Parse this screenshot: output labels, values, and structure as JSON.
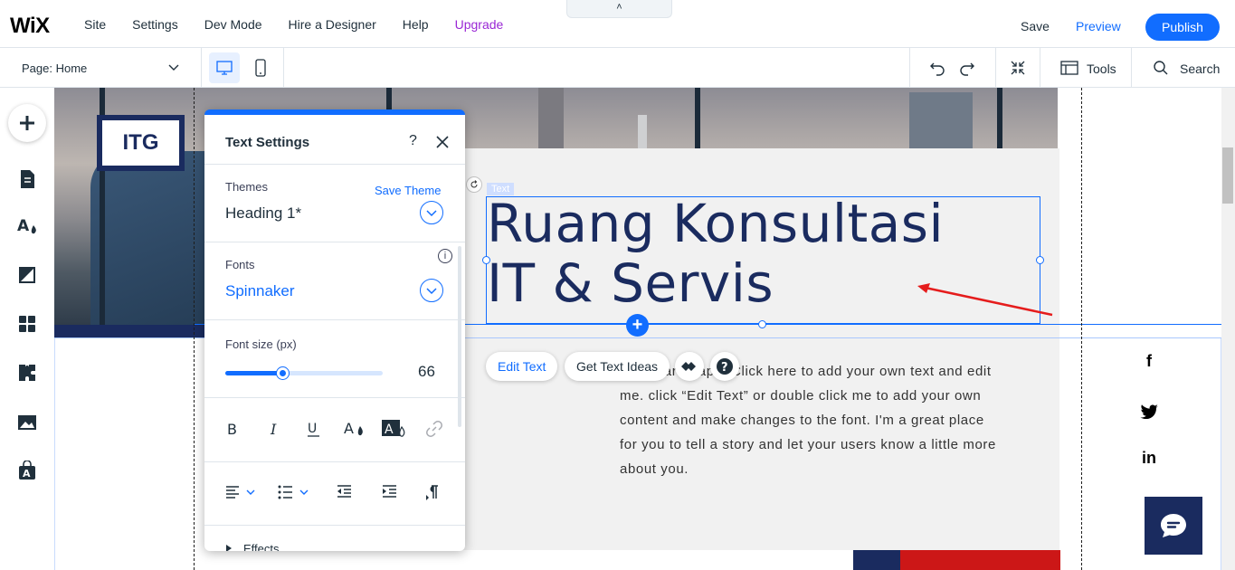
{
  "topbar": {
    "logo": "WiX",
    "nav": [
      "Site",
      "Settings",
      "Dev Mode",
      "Hire a Designer",
      "Help",
      "Upgrade"
    ],
    "collapse_glyph": "˄",
    "save": "Save",
    "preview": "Preview",
    "publish": "Publish"
  },
  "subbar": {
    "page_label": "Page: Home",
    "tools": "Tools",
    "search": "Search"
  },
  "leftbar": {
    "items": [
      "add-icon",
      "pages-icon",
      "design-icon",
      "background-icon",
      "apps-icon",
      "business-icon",
      "media-icon",
      "market-icon"
    ]
  },
  "canvas": {
    "logo_text": "ITG",
    "text_tag": "Text",
    "heading_line1": "Ruang Konsultasi",
    "heading_line2": "IT & Servis",
    "paragraph": "I'm a paragraph. Click here to add your own text and edit me. click “Edit Text” or double click me to add your own content and make changes to the font. I'm a great place for you to tell a story and let your users know a little more about you.",
    "edit_text": "Edit Text",
    "get_text_ideas": "Get Text Ideas",
    "social": {
      "facebook": "f",
      "twitter": "twitter-icon",
      "linkedin": "in"
    }
  },
  "panel": {
    "title": "Text Settings",
    "help": "?",
    "themes_label": "Themes",
    "save_theme": "Save Theme",
    "theme_value": "Heading 1*",
    "fonts_label": "Fonts",
    "font_value": "Spinnaker",
    "info": "i",
    "font_size_label": "Font size (px)",
    "font_size_value": "66",
    "font_size_fraction": 0.36,
    "effects": "Effects"
  },
  "colors": {
    "accent": "#116dff",
    "upgrade": "#9a27d5",
    "navy": "#1a2b5f",
    "red": "#cc1717"
  }
}
